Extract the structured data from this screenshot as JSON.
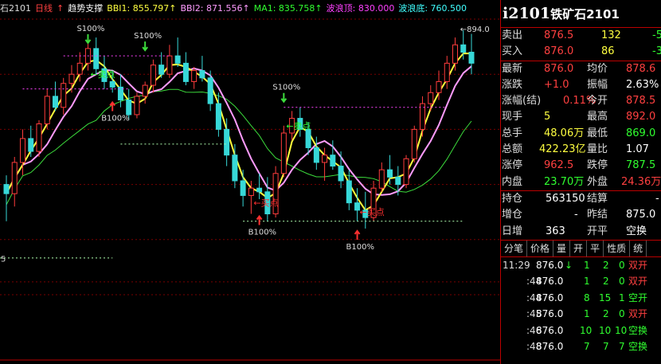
{
  "header": {
    "symbol_fragment": "石2101",
    "period": "日线",
    "indicator_arrow": "↑",
    "indicator_name": "趋势支撑",
    "bbi1": "BBI1: 855.797↑",
    "bbi2": "BBI2: 871.556↑",
    "ma1": "MA1: 835.758↑",
    "wave_top": "波浪顶: 830.000",
    "wave_bottom": "波浪底: 760.500"
  },
  "chart_labels": {
    "max_price": "894.0",
    "sell_signal": "卖点",
    "buy_signal": "买点",
    "s100": "S100%",
    "b100": "B100%",
    "left_fragment": "5"
  },
  "colors": {
    "up": "#ff3c3c",
    "down": "#37d8d8",
    "ma_yellow": "#ffff3c",
    "ma_pink": "#ff9cff",
    "ma_green": "#3cdc3c",
    "grid": "#7a0000",
    "sell_line": "#ff44ff",
    "support_line": "#b0ffb0"
  },
  "sidepanel": {
    "code": "i2101",
    "name": "铁矿石2101",
    "quote": [
      {
        "label": "卖出",
        "value": "876.5",
        "vol": "132",
        "extra": "-5"
      },
      {
        "label": "买入",
        "value": "876.0",
        "vol": "86",
        "extra": "-3"
      }
    ],
    "stats": [
      {
        "l1": "最新",
        "v1": "876.0",
        "l2": "均价",
        "v2": "878.6"
      },
      {
        "l1": "涨跌",
        "v1": "+1.0",
        "l2": "振幅",
        "v2": "2.63%"
      },
      {
        "l1": "涨幅(结)",
        "v1": "0.11%",
        "l2": "今开",
        "v2": "878.5"
      },
      {
        "l1": "现手",
        "v1": "5",
        "l2": "最高",
        "v2": "892.0"
      },
      {
        "l1": "总手",
        "v1": "48.06万",
        "l2": "最低",
        "v2": "869.0"
      },
      {
        "l1": "总额",
        "v1": "422.23亿",
        "l2": "量比",
        "v2": "1.07"
      },
      {
        "l1": "涨停",
        "v1": "962.5",
        "l2": "跌停",
        "v2": "787.5"
      },
      {
        "l1": "内盘",
        "v1": "23.70万",
        "l2": "外盘",
        "v2": "24.36万"
      }
    ],
    "pos": [
      {
        "l1": "持仓",
        "v1": "563150",
        "l2": "结算",
        "v2": "-"
      },
      {
        "l1": "增仓",
        "v1": "-",
        "l2": "昨结",
        "v2": "875.0"
      },
      {
        "l1": "日增",
        "v1": "363",
        "l2": "开平",
        "v2": "空换"
      }
    ],
    "tabs": [
      "分笔",
      "价格",
      "量",
      "开",
      "平",
      "性质",
      "统"
    ],
    "ticks": [
      {
        "time": "11:29",
        "price": "876.0",
        "arrow": "↓",
        "vol": "1",
        "open": "2",
        "close": "0",
        "type": "双开"
      },
      {
        "time": ":44",
        "price": "876.0",
        "arrow": "",
        "vol": "1",
        "open": "2",
        "close": "0",
        "type": "双开"
      },
      {
        "time": ":44",
        "price": "876.0",
        "arrow": "",
        "vol": "8",
        "open": "15",
        "close": "1",
        "type": "空开"
      },
      {
        "time": ":45",
        "price": "876.0",
        "arrow": "",
        "vol": "1",
        "open": "2",
        "close": "0",
        "type": "双开"
      },
      {
        "time": ":46",
        "price": "876.0",
        "arrow": "",
        "vol": "10",
        "open": "10",
        "close": "10",
        "type": "空换"
      },
      {
        "time": ":48",
        "price": "876.0",
        "arrow": "",
        "vol": "7",
        "open": "7",
        "close": "7",
        "type": "空换"
      }
    ]
  },
  "chart_data": {
    "type": "candlestick",
    "ylim": [
      750,
      900
    ],
    "candles": [
      [
        810,
        815,
        790,
        805
      ],
      [
        805,
        825,
        798,
        822
      ],
      [
        822,
        840,
        815,
        835
      ],
      [
        835,
        842,
        825,
        828
      ],
      [
        828,
        845,
        825,
        843
      ],
      [
        843,
        862,
        840,
        858
      ],
      [
        858,
        866,
        850,
        852
      ],
      [
        852,
        868,
        848,
        865
      ],
      [
        865,
        875,
        860,
        870
      ],
      [
        870,
        882,
        866,
        876
      ],
      [
        876,
        888,
        872,
        884
      ],
      [
        884,
        890,
        870,
        873
      ],
      [
        873,
        880,
        862,
        866
      ],
      [
        866,
        872,
        860,
        863
      ],
      [
        863,
        870,
        852,
        856
      ],
      [
        856,
        862,
        845,
        848
      ],
      [
        848,
        860,
        846,
        858
      ],
      [
        858,
        866,
        854,
        864
      ],
      [
        864,
        878,
        860,
        875
      ],
      [
        875,
        882,
        868,
        870
      ],
      [
        870,
        886,
        868,
        880
      ],
      [
        880,
        890,
        874,
        876
      ],
      [
        876,
        882,
        864,
        866
      ],
      [
        866,
        874,
        862,
        872
      ],
      [
        872,
        880,
        866,
        868
      ],
      [
        868,
        872,
        850,
        854
      ],
      [
        854,
        860,
        836,
        840
      ],
      [
        840,
        846,
        820,
        826
      ],
      [
        826,
        832,
        808,
        812
      ],
      [
        812,
        818,
        798,
        804
      ],
      [
        804,
        812,
        794,
        808
      ],
      [
        808,
        816,
        802,
        806
      ],
      [
        806,
        814,
        790,
        794
      ],
      [
        794,
        820,
        792,
        816
      ],
      [
        816,
        842,
        814,
        838
      ],
      [
        838,
        850,
        834,
        846
      ],
      [
        846,
        852,
        836,
        840
      ],
      [
        840,
        844,
        826,
        830
      ],
      [
        830,
        836,
        818,
        822
      ],
      [
        822,
        830,
        812,
        826
      ],
      [
        826,
        834,
        818,
        820
      ],
      [
        820,
        828,
        808,
        812
      ],
      [
        812,
        818,
        796,
        800
      ],
      [
        800,
        808,
        790,
        796
      ],
      [
        796,
        806,
        786,
        792
      ],
      [
        792,
        812,
        790,
        808
      ],
      [
        808,
        822,
        806,
        818
      ],
      [
        818,
        826,
        810,
        814
      ],
      [
        814,
        820,
        804,
        810
      ],
      [
        810,
        826,
        808,
        824
      ],
      [
        824,
        842,
        822,
        840
      ],
      [
        840,
        858,
        836,
        854
      ],
      [
        854,
        864,
        850,
        860
      ],
      [
        860,
        872,
        856,
        866
      ],
      [
        866,
        880,
        862,
        876
      ],
      [
        876,
        890,
        872,
        886
      ],
      [
        886,
        894,
        878,
        882
      ],
      [
        882,
        892,
        870,
        876
      ]
    ]
  }
}
